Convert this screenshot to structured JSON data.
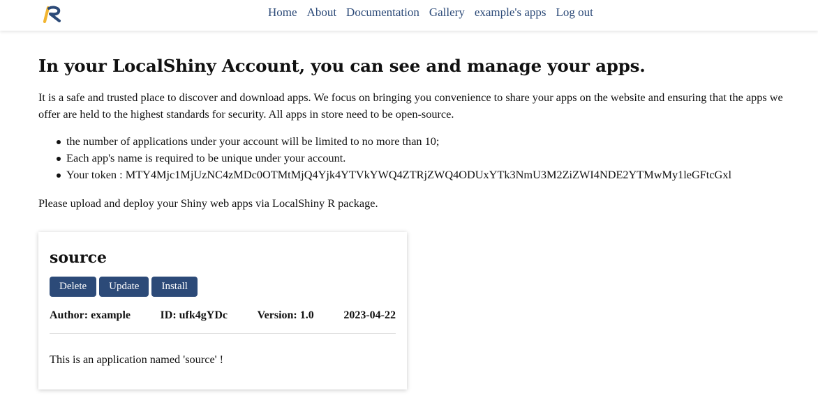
{
  "nav": {
    "logo_name": "localshiny-logo",
    "colors": {
      "logo_yellow": "#f2b530",
      "logo_blue": "#2c4a78"
    },
    "links": [
      "Home",
      "About",
      "Documentation",
      "Gallery",
      "example's apps",
      "Log out"
    ]
  },
  "main": {
    "heading": "In your LocalShiny Account, you can see and manage your apps.",
    "intro": "It is a safe and trusted place to discover and download apps. We focus on bringing you convenience to share your apps on the website and ensuring that the apps we offer are held to the highest standards for security. All apps in store need to be open-source.",
    "bullets": [
      "the number of applications under your account will be limited to no more than 10;",
      "Each app's name is required to be unique under your account.",
      "Your token : MTY4Mjc1MjUzNC4zMDc0OTMtMjQ4Yjk4YTVkYWQ4ZTRjZWQ4ODUxYTk3NmU3M2ZiZWI4NDE2YTMwMy1leGFtcGxl"
    ],
    "upload_note": "Please upload and deploy your Shiny web apps via LocalShiny R package."
  },
  "app_card": {
    "title": "source",
    "buttons": {
      "delete": "Delete",
      "update": "Update",
      "install": "Install"
    },
    "author": "Author: example",
    "id": "ID: ufk4gYDc",
    "version": "Version: 1.0",
    "date": "2023-04-22",
    "description": "This is an application named 'source' !",
    "button_color": "#2c4a78"
  }
}
